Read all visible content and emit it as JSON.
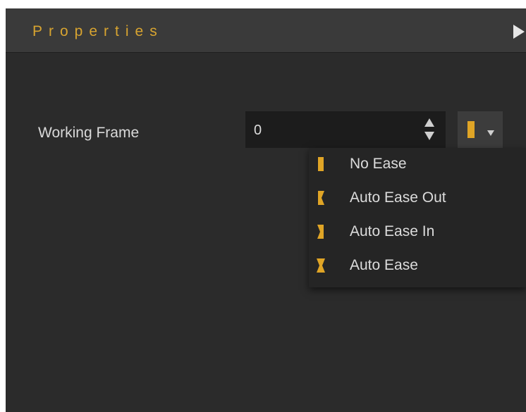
{
  "panel": {
    "title": "Properties"
  },
  "working_frame": {
    "label": "Working Frame",
    "value": "0"
  },
  "ease": {
    "selected": "No Ease",
    "options": [
      {
        "label": "No Ease",
        "icon": "no-ease-icon"
      },
      {
        "label": "Auto Ease Out",
        "icon": "auto-ease-out-icon"
      },
      {
        "label": "Auto Ease In",
        "icon": "auto-ease-in-icon"
      },
      {
        "label": "Auto Ease",
        "icon": "auto-ease-icon"
      }
    ]
  },
  "colors": {
    "accent": "#d8a430",
    "panel_bg": "#2b2b2b",
    "header_bg": "#3a3a3a",
    "input_bg": "#1c1c1c",
    "text": "#dcdcdc"
  }
}
